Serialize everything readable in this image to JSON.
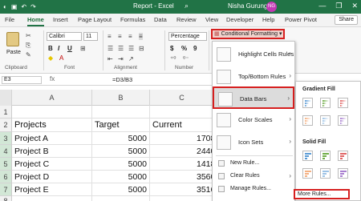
{
  "titlebar": {
    "autosave_icon": "autosave-toggle-icon",
    "save_icon": "save-icon",
    "undo_icon": "undo-icon",
    "doc_title": "Report - Excel",
    "user_name": "Nisha Gurung",
    "user_initials": "NG",
    "minimize": "—",
    "restore": "❐",
    "close": "✕",
    "search": "⌕"
  },
  "tabs": [
    {
      "label": "File"
    },
    {
      "label": "Home"
    },
    {
      "label": "Insert"
    },
    {
      "label": "Page Layout"
    },
    {
      "label": "Formulas"
    },
    {
      "label": "Data"
    },
    {
      "label": "Review"
    },
    {
      "label": "View"
    },
    {
      "label": "Developer"
    },
    {
      "label": "Help"
    },
    {
      "label": "Power Pivot"
    }
  ],
  "share_label": "Share",
  "ribbon": {
    "paste_label": "Paste",
    "clipboard_label": "Clipboard",
    "font_label": "Font",
    "font_name": "Calibri",
    "font_size": "11",
    "alignment_label": "Alignment",
    "number_format": "Percentage",
    "number_label": "Number",
    "cf_label": "Conditional Formatting",
    "cf_arrow": "▾",
    "bold": "B",
    "italic": "I",
    "underline": "U",
    "currency": "$",
    "percent": "%",
    "comma": "9"
  },
  "formula_bar": {
    "name_box": "E3",
    "fx": "fx",
    "formula": "=D3/B3"
  },
  "grid": {
    "columns": [
      "A",
      "B",
      "C"
    ],
    "rows": [
      "1",
      "2",
      "3",
      "4",
      "5",
      "6",
      "7",
      "8"
    ],
    "header": {
      "projects": "Projects",
      "target": "Target",
      "current": "Current"
    },
    "data": [
      {
        "project": "Project A",
        "target": "5000",
        "current": "1708"
      },
      {
        "project": "Project B",
        "target": "5000",
        "current": "2440"
      },
      {
        "project": "Project C",
        "target": "5000",
        "current": "1418"
      },
      {
        "project": "Project D",
        "target": "5000",
        "current": "3560"
      },
      {
        "project": "Project E",
        "target": "5000",
        "current": "3516"
      }
    ]
  },
  "menu": {
    "highlight": "Highlight Cells Rules",
    "topbottom": "Top/Bottom Rules",
    "databars": "Data Bars",
    "colorscales": "Color Scales",
    "iconsets": "Icon Sets",
    "newrule": "New Rule...",
    "clearrules": "Clear Rules",
    "managerules": "Manage Rules...",
    "arrow": "›"
  },
  "submenu": {
    "gradient_fill": "Gradient Fill",
    "solid_fill": "Solid Fill",
    "more_rules": "More Rules...",
    "colors": [
      "#5b9bd5",
      "#70ad47",
      "#e06666",
      "#f4b183",
      "#9dc3e6",
      "#a980d0"
    ]
  }
}
